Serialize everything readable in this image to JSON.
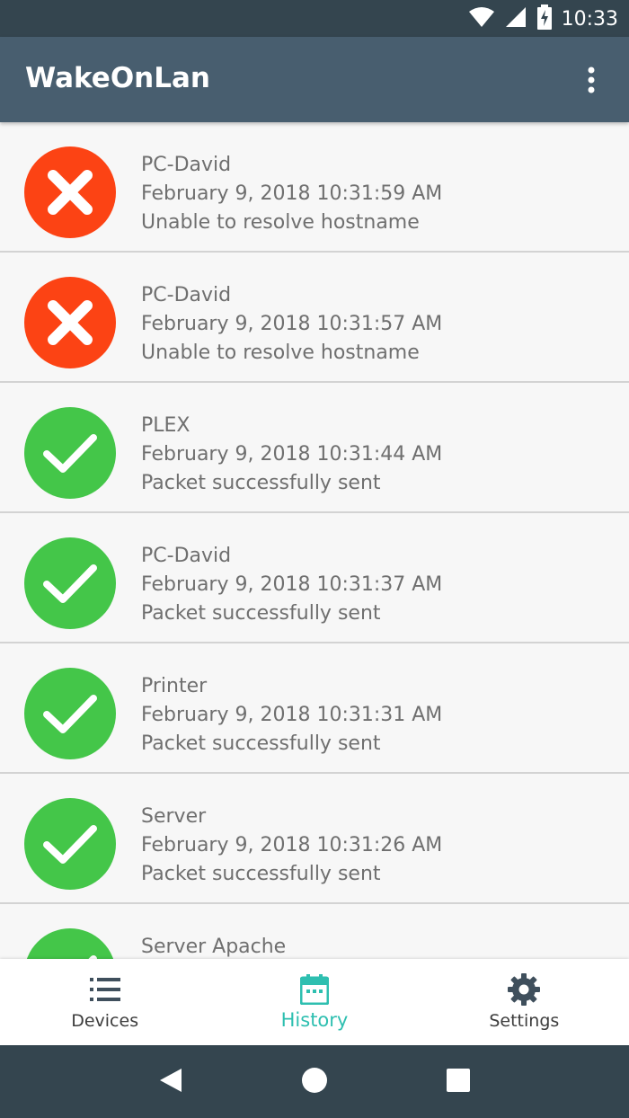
{
  "status_bar": {
    "time": "10:33",
    "icons": [
      "wifi-icon",
      "cellular-signal-icon",
      "battery-charging-icon"
    ]
  },
  "app_bar": {
    "title": "WakeOnLan",
    "overflow_icon": "more-vert-icon"
  },
  "history": {
    "items": [
      {
        "device": "PC-David",
        "timestamp": "February 9, 2018 10:31:59 AM",
        "message": "Unable to resolve hostname",
        "status": "error"
      },
      {
        "device": "PC-David",
        "timestamp": "February 9, 2018 10:31:57 AM",
        "message": "Unable to resolve hostname",
        "status": "error"
      },
      {
        "device": "PLEX",
        "timestamp": "February 9, 2018 10:31:44 AM",
        "message": "Packet successfully sent",
        "status": "success"
      },
      {
        "device": "PC-David",
        "timestamp": "February 9, 2018 10:31:37 AM",
        "message": "Packet successfully sent",
        "status": "success"
      },
      {
        "device": "Printer",
        "timestamp": "February 9, 2018 10:31:31 AM",
        "message": "Packet successfully sent",
        "status": "success"
      },
      {
        "device": "Server",
        "timestamp": "February 9, 2018 10:31:26 AM",
        "message": "Packet successfully sent",
        "status": "success"
      },
      {
        "device": "Server Apache",
        "timestamp": "",
        "message": "",
        "status": "success"
      }
    ]
  },
  "bottom_nav": {
    "items": [
      {
        "label": "Devices",
        "icon": "list-icon",
        "active": false
      },
      {
        "label": "History",
        "icon": "calendar-icon",
        "active": true
      },
      {
        "label": "Settings",
        "icon": "gear-icon",
        "active": false
      }
    ]
  },
  "colors": {
    "status_bar": "#34454f",
    "app_bar": "#485e6f",
    "error": "#fc4314",
    "success": "#44c649",
    "accent": "#2ebfb0"
  }
}
